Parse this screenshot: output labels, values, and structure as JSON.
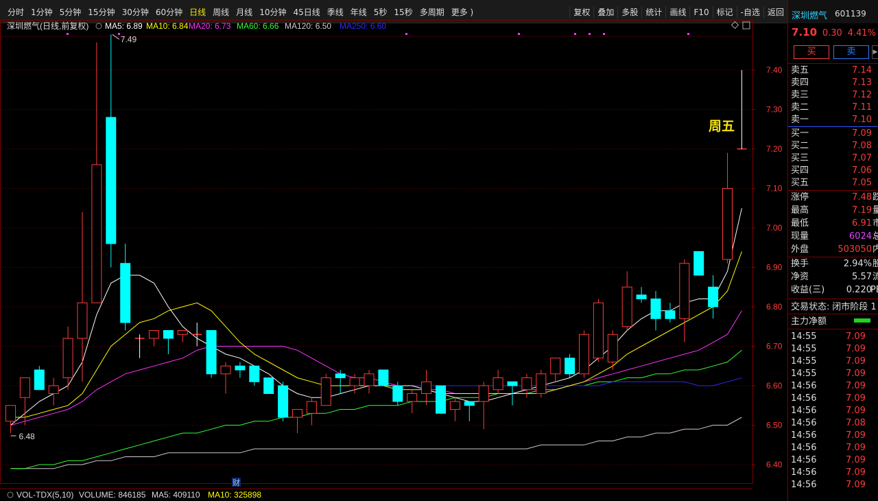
{
  "toolbar": {
    "periods": [
      "分时",
      "1分钟",
      "5分钟",
      "15分钟",
      "30分钟",
      "60分钟",
      "日线",
      "周线",
      "月线",
      "10分钟",
      "45日线",
      "季线",
      "年线",
      "5秒",
      "15秒",
      "多周期",
      "更多 )"
    ],
    "active_period": "日线",
    "tools": [
      "复权",
      "叠加",
      "多股",
      "统计",
      "画线",
      "F10",
      "标记",
      "-自选",
      "返回"
    ]
  },
  "chart_header": {
    "title": "深圳燃气(日线,前复权)",
    "ma_items": [
      {
        "label": "MA5: 6.89",
        "color": "#ffffff"
      },
      {
        "label": "MA10: 6.84",
        "color": "#ffff00"
      },
      {
        "label": "MA20: 6.73",
        "color": "#ff33ff"
      },
      {
        "label": "MA60: 6.66",
        "color": "#33ff33"
      },
      {
        "label": "MA120: 6.50",
        "color": "#cccccc"
      },
      {
        "label": "MA250: 6.60",
        "color": "#2a2aff"
      }
    ]
  },
  "annotations": {
    "weekday_label": "周五",
    "high_label": "7.49",
    "low_label": "6.48",
    "finance_marker": "财"
  },
  "volume_header": {
    "name": "VOL-TDX(5,10)",
    "volume": "VOLUME: 846185",
    "ma5": "MA5: 409110",
    "ma10": "MA10: 325898"
  },
  "colors": {
    "up": "#ff3b3b",
    "down": "#00ffff",
    "ma5": "#ffffff",
    "ma10": "#ffff00",
    "ma20": "#ff33ff",
    "ma60": "#33ff33",
    "ma120": "#cccccc",
    "ma250": "#2a2aff"
  },
  "chart_data": {
    "type": "candlestick",
    "y_axis_ticks": [
      "7.40",
      "7.30",
      "7.20",
      "7.10",
      "7.00",
      "6.90",
      "6.80",
      "6.70",
      "6.60",
      "6.50",
      "6.40"
    ],
    "ylim": [
      6.35,
      7.45
    ],
    "candles": [
      {
        "o": 6.51,
        "h": 6.55,
        "l": 6.48,
        "c": 6.55
      },
      {
        "o": 6.57,
        "h": 6.62,
        "l": 6.5,
        "c": 6.62
      },
      {
        "o": 6.64,
        "h": 6.65,
        "l": 6.59,
        "c": 6.59
      },
      {
        "o": 6.58,
        "h": 6.62,
        "l": 6.55,
        "c": 6.6
      },
      {
        "o": 6.62,
        "h": 6.75,
        "l": 6.59,
        "c": 6.72
      },
      {
        "o": 6.72,
        "h": 7.04,
        "l": 6.61,
        "c": 6.81
      },
      {
        "o": 6.81,
        "h": 7.47,
        "l": 6.81,
        "c": 7.16
      },
      {
        "o": 7.28,
        "h": 7.49,
        "l": 6.9,
        "c": 6.96
      },
      {
        "o": 6.91,
        "h": 6.96,
        "l": 6.74,
        "c": 6.76
      },
      {
        "o": 6.72,
        "h": 6.73,
        "l": 6.67,
        "c": 6.72
      },
      {
        "o": 6.72,
        "h": 6.74,
        "l": 6.7,
        "c": 6.74
      },
      {
        "o": 6.74,
        "h": 6.74,
        "l": 6.68,
        "c": 6.72
      },
      {
        "o": 6.73,
        "h": 6.74,
        "l": 6.71,
        "c": 6.74
      },
      {
        "o": 6.73,
        "h": 6.76,
        "l": 6.7,
        "c": 6.73
      },
      {
        "o": 6.74,
        "h": 6.74,
        "l": 6.62,
        "c": 6.63
      },
      {
        "o": 6.63,
        "h": 6.66,
        "l": 6.58,
        "c": 6.65
      },
      {
        "o": 6.65,
        "h": 6.66,
        "l": 6.62,
        "c": 6.64
      },
      {
        "o": 6.65,
        "h": 6.65,
        "l": 6.6,
        "c": 6.61
      },
      {
        "o": 6.62,
        "h": 6.62,
        "l": 6.58,
        "c": 6.58
      },
      {
        "o": 6.6,
        "h": 6.61,
        "l": 6.51,
        "c": 6.52
      },
      {
        "o": 6.52,
        "h": 6.54,
        "l": 6.48,
        "c": 6.54
      },
      {
        "o": 6.53,
        "h": 6.57,
        "l": 6.5,
        "c": 6.56
      },
      {
        "o": 6.55,
        "h": 6.63,
        "l": 6.55,
        "c": 6.62
      },
      {
        "o": 6.63,
        "h": 6.64,
        "l": 6.58,
        "c": 6.62
      },
      {
        "o": 6.6,
        "h": 6.63,
        "l": 6.58,
        "c": 6.62
      },
      {
        "o": 6.6,
        "h": 6.64,
        "l": 6.58,
        "c": 6.63
      },
      {
        "o": 6.64,
        "h": 6.64,
        "l": 6.6,
        "c": 6.6
      },
      {
        "o": 6.6,
        "h": 6.61,
        "l": 6.55,
        "c": 6.56
      },
      {
        "o": 6.56,
        "h": 6.59,
        "l": 6.53,
        "c": 6.58
      },
      {
        "o": 6.58,
        "h": 6.64,
        "l": 6.55,
        "c": 6.61
      },
      {
        "o": 6.6,
        "h": 6.6,
        "l": 6.53,
        "c": 6.53
      },
      {
        "o": 6.54,
        "h": 6.57,
        "l": 6.51,
        "c": 6.56
      },
      {
        "o": 6.56,
        "h": 6.56,
        "l": 6.51,
        "c": 6.55
      },
      {
        "o": 6.56,
        "h": 6.61,
        "l": 6.49,
        "c": 6.6
      },
      {
        "o": 6.59,
        "h": 6.64,
        "l": 6.58,
        "c": 6.62
      },
      {
        "o": 6.61,
        "h": 6.61,
        "l": 6.55,
        "c": 6.6
      },
      {
        "o": 6.59,
        "h": 6.63,
        "l": 6.57,
        "c": 6.62
      },
      {
        "o": 6.58,
        "h": 6.64,
        "l": 6.57,
        "c": 6.63
      },
      {
        "o": 6.63,
        "h": 6.67,
        "l": 6.61,
        "c": 6.67
      },
      {
        "o": 6.67,
        "h": 6.68,
        "l": 6.62,
        "c": 6.63
      },
      {
        "o": 6.63,
        "h": 6.74,
        "l": 6.62,
        "c": 6.73
      },
      {
        "o": 6.67,
        "h": 6.82,
        "l": 6.66,
        "c": 6.81
      },
      {
        "o": 6.66,
        "h": 6.74,
        "l": 6.64,
        "c": 6.73
      },
      {
        "o": 6.75,
        "h": 6.89,
        "l": 6.74,
        "c": 6.85
      },
      {
        "o": 6.83,
        "h": 6.85,
        "l": 6.81,
        "c": 6.82
      },
      {
        "o": 6.82,
        "h": 6.84,
        "l": 6.74,
        "c": 6.77
      },
      {
        "o": 6.79,
        "h": 6.81,
        "l": 6.76,
        "c": 6.77
      },
      {
        "o": 6.77,
        "h": 6.92,
        "l": 6.71,
        "c": 6.91
      },
      {
        "o": 6.94,
        "h": 6.94,
        "l": 6.88,
        "c": 6.88
      },
      {
        "o": 6.85,
        "h": 6.88,
        "l": 6.77,
        "c": 6.8
      },
      {
        "o": 6.92,
        "h": 7.19,
        "l": 6.91,
        "c": 7.1
      },
      {
        "o": 7.2,
        "h": 7.4,
        "l": 7.2,
        "c": 7.2
      }
    ],
    "ma5": [
      6.5,
      6.53,
      6.56,
      6.58,
      6.6,
      6.66,
      6.78,
      6.86,
      6.88,
      6.88,
      6.86,
      6.8,
      6.75,
      6.72,
      6.7,
      6.68,
      6.67,
      6.65,
      6.63,
      6.6,
      6.58,
      6.57,
      6.57,
      6.58,
      6.59,
      6.6,
      6.6,
      6.6,
      6.6,
      6.59,
      6.58,
      6.57,
      6.56,
      6.56,
      6.57,
      6.58,
      6.59,
      6.6,
      6.61,
      6.62,
      6.64,
      6.67,
      6.7,
      6.74,
      6.77,
      6.79,
      6.79,
      6.81,
      6.82,
      6.82,
      6.89,
      7.05
    ],
    "ma10": [
      6.52,
      6.52,
      6.53,
      6.54,
      6.55,
      6.58,
      6.64,
      6.7,
      6.73,
      6.76,
      6.77,
      6.79,
      6.8,
      6.81,
      6.79,
      6.75,
      6.71,
      6.68,
      6.66,
      6.64,
      6.62,
      6.61,
      6.6,
      6.6,
      6.6,
      6.6,
      6.6,
      6.59,
      6.59,
      6.59,
      6.58,
      6.58,
      6.58,
      6.58,
      6.58,
      6.58,
      6.58,
      6.58,
      6.59,
      6.6,
      6.61,
      6.63,
      6.65,
      6.68,
      6.7,
      6.72,
      6.74,
      6.76,
      6.78,
      6.8,
      6.84,
      6.94
    ],
    "ma20": [
      6.5,
      6.51,
      6.52,
      6.53,
      6.54,
      6.56,
      6.59,
      6.61,
      6.63,
      6.64,
      6.65,
      6.66,
      6.67,
      6.69,
      6.7,
      6.7,
      6.7,
      6.7,
      6.7,
      6.7,
      6.69,
      6.67,
      6.65,
      6.63,
      6.62,
      6.62,
      6.61,
      6.6,
      6.6,
      6.59,
      6.59,
      6.58,
      6.58,
      6.58,
      6.58,
      6.58,
      6.59,
      6.59,
      6.59,
      6.6,
      6.61,
      6.62,
      6.63,
      6.64,
      6.65,
      6.66,
      6.67,
      6.68,
      6.69,
      6.71,
      6.73,
      6.79
    ],
    "ma60": [
      6.39,
      6.39,
      6.4,
      6.4,
      6.41,
      6.41,
      6.42,
      6.43,
      6.44,
      6.45,
      6.46,
      6.47,
      6.48,
      6.48,
      6.49,
      6.5,
      6.5,
      6.51,
      6.51,
      6.52,
      6.52,
      6.53,
      6.53,
      6.54,
      6.54,
      6.55,
      6.55,
      6.55,
      6.56,
      6.56,
      6.56,
      6.57,
      6.57,
      6.57,
      6.58,
      6.58,
      6.58,
      6.59,
      6.59,
      6.6,
      6.6,
      6.61,
      6.61,
      6.62,
      6.62,
      6.63,
      6.63,
      6.64,
      6.64,
      6.65,
      6.66,
      6.69
    ],
    "ma120": [
      6.39,
      6.39,
      6.39,
      6.39,
      6.4,
      6.4,
      6.41,
      6.41,
      6.42,
      6.42,
      6.42,
      6.43,
      6.43,
      6.43,
      6.43,
      6.43,
      6.43,
      6.44,
      6.44,
      6.44,
      6.44,
      6.44,
      6.44,
      6.44,
      6.44,
      6.44,
      6.44,
      6.44,
      6.44,
      6.44,
      6.44,
      6.44,
      6.44,
      6.44,
      6.44,
      6.44,
      6.44,
      6.45,
      6.45,
      6.45,
      6.45,
      6.46,
      6.46,
      6.47,
      6.47,
      6.48,
      6.48,
      6.49,
      6.49,
      6.5,
      6.5,
      6.52
    ],
    "ma250": [
      null,
      null,
      null,
      null,
      null,
      null,
      null,
      null,
      null,
      null,
      null,
      null,
      null,
      null,
      null,
      null,
      null,
      null,
      null,
      null,
      null,
      null,
      null,
      null,
      null,
      null,
      6.6,
      6.6,
      6.6,
      6.6,
      6.6,
      6.6,
      6.6,
      6.6,
      6.6,
      6.6,
      6.6,
      6.6,
      6.6,
      6.6,
      6.6,
      6.6,
      6.61,
      6.61,
      6.61,
      6.61,
      6.61,
      6.61,
      6.6,
      6.6,
      6.61,
      6.62
    ]
  },
  "right_panel": {
    "stock_name": "深圳燃气",
    "stock_code": "601139",
    "price": "7.10",
    "change": "0.30",
    "change_pct": "4.41%",
    "buy_label": "买",
    "sell_label": "卖",
    "collapse_icon": "chevron-right",
    "asks": [
      {
        "label": "卖五",
        "price": "7.14"
      },
      {
        "label": "卖四",
        "price": "7.13"
      },
      {
        "label": "卖三",
        "price": "7.12"
      },
      {
        "label": "卖二",
        "price": "7.11"
      },
      {
        "label": "卖一",
        "price": "7.10"
      }
    ],
    "bids": [
      {
        "label": "买一",
        "price": "7.09"
      },
      {
        "label": "买二",
        "price": "7.08"
      },
      {
        "label": "买三",
        "price": "7.07"
      },
      {
        "label": "买四",
        "price": "7.06"
      },
      {
        "label": "买五",
        "price": "7.05"
      }
    ],
    "stats": [
      {
        "label": "涨停",
        "value": "7.48",
        "extra": "跌",
        "color": "#ff3b3b"
      },
      {
        "label": "最高",
        "value": "7.19",
        "extra": "量",
        "color": "#ff3b3b"
      },
      {
        "label": "最低",
        "value": "6.91",
        "extra": "市",
        "color": "#ff3b3b"
      },
      {
        "label": "现量",
        "value": "6024",
        "extra": "总",
        "color": "#e040ff"
      },
      {
        "label": "外盘",
        "value": "503050",
        "extra": "内",
        "color": "#ff3b3b"
      }
    ],
    "stats2": [
      {
        "label": "换手",
        "value": "2.94%",
        "extra": "股"
      },
      {
        "label": "净资",
        "value": "5.57",
        "extra": "流"
      },
      {
        "label": "收益(三)",
        "value": "0.220",
        "extra": "PE"
      }
    ],
    "status_label": "交易状态:",
    "status_value": "闭市阶段 1",
    "netflow_label": "主力净额",
    "ticks": [
      {
        "time": "14:55",
        "price": "7.09"
      },
      {
        "time": "14:55",
        "price": "7.09"
      },
      {
        "time": "14:55",
        "price": "7.09"
      },
      {
        "time": "14:55",
        "price": "7.09"
      },
      {
        "time": "14:56",
        "price": "7.09"
      },
      {
        "time": "14:56",
        "price": "7.09"
      },
      {
        "time": "14:56",
        "price": "7.09"
      },
      {
        "time": "14:56",
        "price": "7.08"
      },
      {
        "time": "14:56",
        "price": "7.09"
      },
      {
        "time": "14:56",
        "price": "7.09"
      },
      {
        "time": "14:56",
        "price": "7.09"
      },
      {
        "time": "14:56",
        "price": "7.09"
      },
      {
        "time": "14:56",
        "price": "7.09"
      }
    ]
  }
}
